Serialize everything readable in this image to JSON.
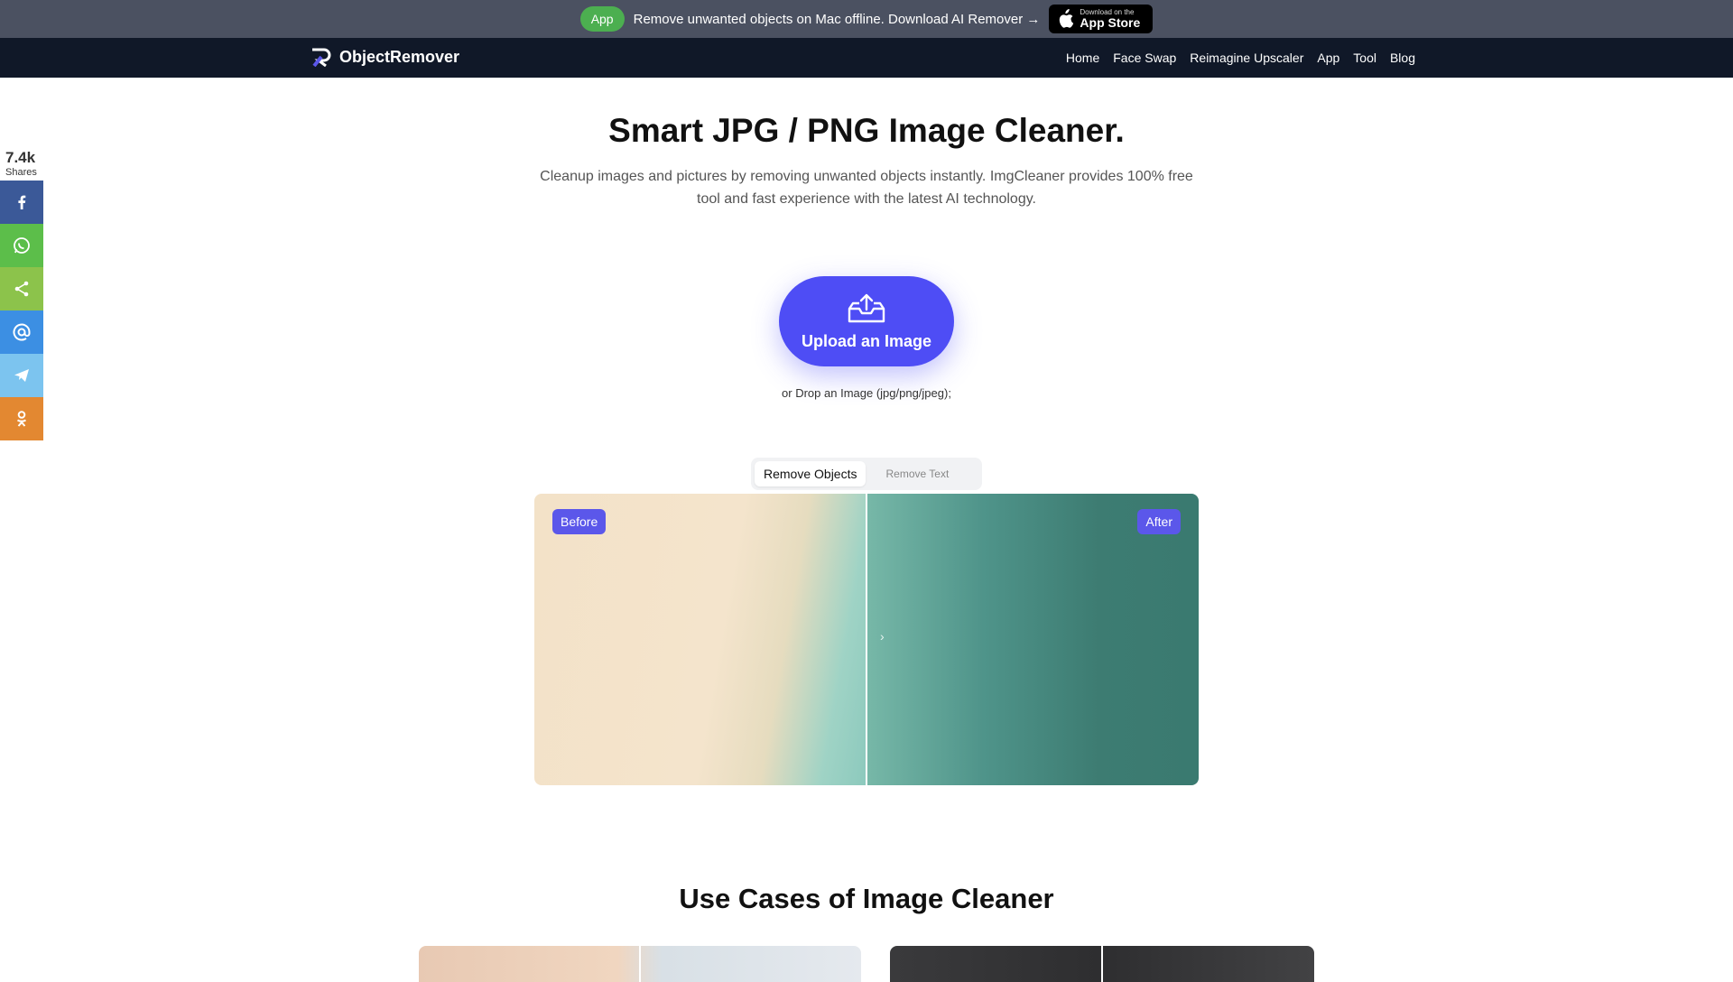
{
  "promo": {
    "pill": "App",
    "text": "Remove unwanted objects on Mac offline. Download AI Remover →",
    "appstore_small": "Download on the",
    "appstore_big": "App Store"
  },
  "nav": {
    "logo": "ObjectRemover",
    "items": [
      "Home",
      "Face Swap",
      "Reimagine Upscaler",
      "App",
      "Tool",
      "Blog"
    ]
  },
  "social": {
    "count": "7.4k",
    "label": "Shares",
    "buttons": [
      {
        "name": "facebook",
        "color": "#3b5998"
      },
      {
        "name": "whatsapp",
        "color": "#5cbe4a"
      },
      {
        "name": "share",
        "color": "#8cc34b"
      },
      {
        "name": "email",
        "color": "#3c8fe3"
      },
      {
        "name": "telegram",
        "color": "#7cc4ef"
      },
      {
        "name": "odnoklassniki",
        "color": "#e38831"
      }
    ]
  },
  "hero": {
    "title": "Smart JPG / PNG Image Cleaner.",
    "subtitle": "Cleanup images and pictures by removing unwanted objects instantly. ImgCleaner provides 100% free tool and fast experience with the latest AI technology.",
    "upload_label": "Upload an Image",
    "drop_hint": "or Drop an Image (jpg/png/jpeg);"
  },
  "tabs": {
    "active": "Remove Objects",
    "inactive": "Remove Text"
  },
  "compare": {
    "before": "Before",
    "after": "After"
  },
  "use_cases": {
    "title": "Use Cases of Image Cleaner"
  },
  "colors": {
    "accent": "#4e4df5",
    "nav_bg": "#101828",
    "promo_bg": "#4b5161"
  }
}
